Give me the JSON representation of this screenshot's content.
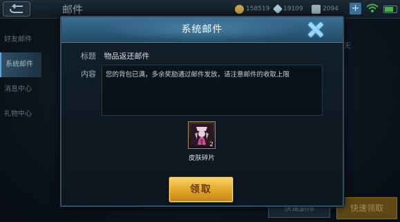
{
  "topbar": {
    "title": "邮件",
    "currencies": [
      {
        "icon": "gold-coin-icon",
        "value": "158519",
        "color": "#c9a64a"
      },
      {
        "icon": "diamond-icon",
        "value": "19109",
        "color": "#a9c7d6"
      },
      {
        "icon": "voucher-icon",
        "value": "2094",
        "color": "#9bb0bd"
      }
    ]
  },
  "sidebar": {
    "items": [
      {
        "label": "好友邮件"
      },
      {
        "label": "系统邮件"
      },
      {
        "label": "消息中心"
      },
      {
        "label": "礼物中心"
      }
    ]
  },
  "background": {
    "right_text": "天",
    "quick_delete": "快速删除",
    "quick_claim": "快速领取"
  },
  "modal": {
    "title": "系统邮件",
    "subject_label": "标题",
    "subject_value": "物品返还邮件",
    "content_label": "内容",
    "content_text": "您的背包已满，多余奖励通过邮件发放，请注意邮件的收取上限",
    "item": {
      "name": "皮肤碎片",
      "count": "2",
      "icon": "skin-fragment-icon"
    },
    "claim_button": "领取"
  },
  "colors": {
    "accent": "#4d88ad",
    "button_gold": "#e2a526"
  }
}
